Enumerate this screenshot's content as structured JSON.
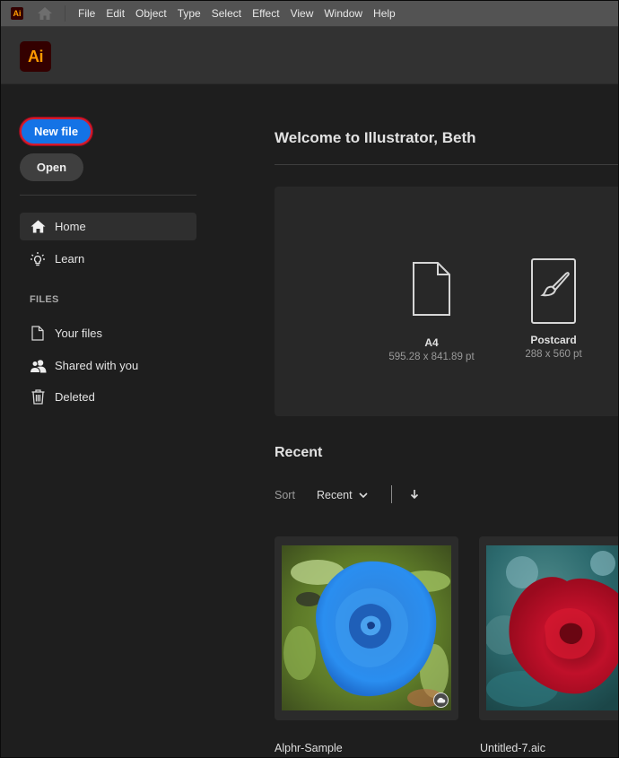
{
  "menubar": {
    "logo_text": "Ai",
    "items": [
      "File",
      "Edit",
      "Object",
      "Type",
      "Select",
      "Effect",
      "View",
      "Window",
      "Help"
    ]
  },
  "header": {
    "logo_text": "Ai"
  },
  "sidebar": {
    "new_file_label": "New file",
    "open_label": "Open",
    "nav": [
      {
        "label": "Home",
        "icon": "home-icon",
        "active": true
      },
      {
        "label": "Learn",
        "icon": "lightbulb-icon",
        "active": false
      }
    ],
    "files_heading": "FILES",
    "files": [
      {
        "label": "Your files",
        "icon": "file-icon"
      },
      {
        "label": "Shared with you",
        "icon": "users-icon"
      },
      {
        "label": "Deleted",
        "icon": "trash-icon"
      }
    ]
  },
  "main": {
    "welcome": "Welcome to Illustrator, Beth",
    "templates": [
      {
        "name": "A4",
        "size": "595.28 x 841.89 pt",
        "icon": "document-icon"
      },
      {
        "name": "Postcard",
        "size": "288 x 560 pt",
        "icon": "brush-document-icon"
      }
    ],
    "recent": {
      "title": "Recent",
      "sort_label": "Sort",
      "sort_value": "Recent",
      "files": [
        {
          "name": "Alphr-Sample",
          "thumbnail": "blue-rose",
          "cloud": true
        },
        {
          "name": "Untitled-7.aic",
          "thumbnail": "red-rose",
          "cloud": false
        }
      ]
    }
  },
  "colors": {
    "accent": "#1473e6",
    "highlight_outline": "#d7192a",
    "ai_brand_bg": "#330000",
    "ai_brand_fg": "#ff9a00"
  }
}
